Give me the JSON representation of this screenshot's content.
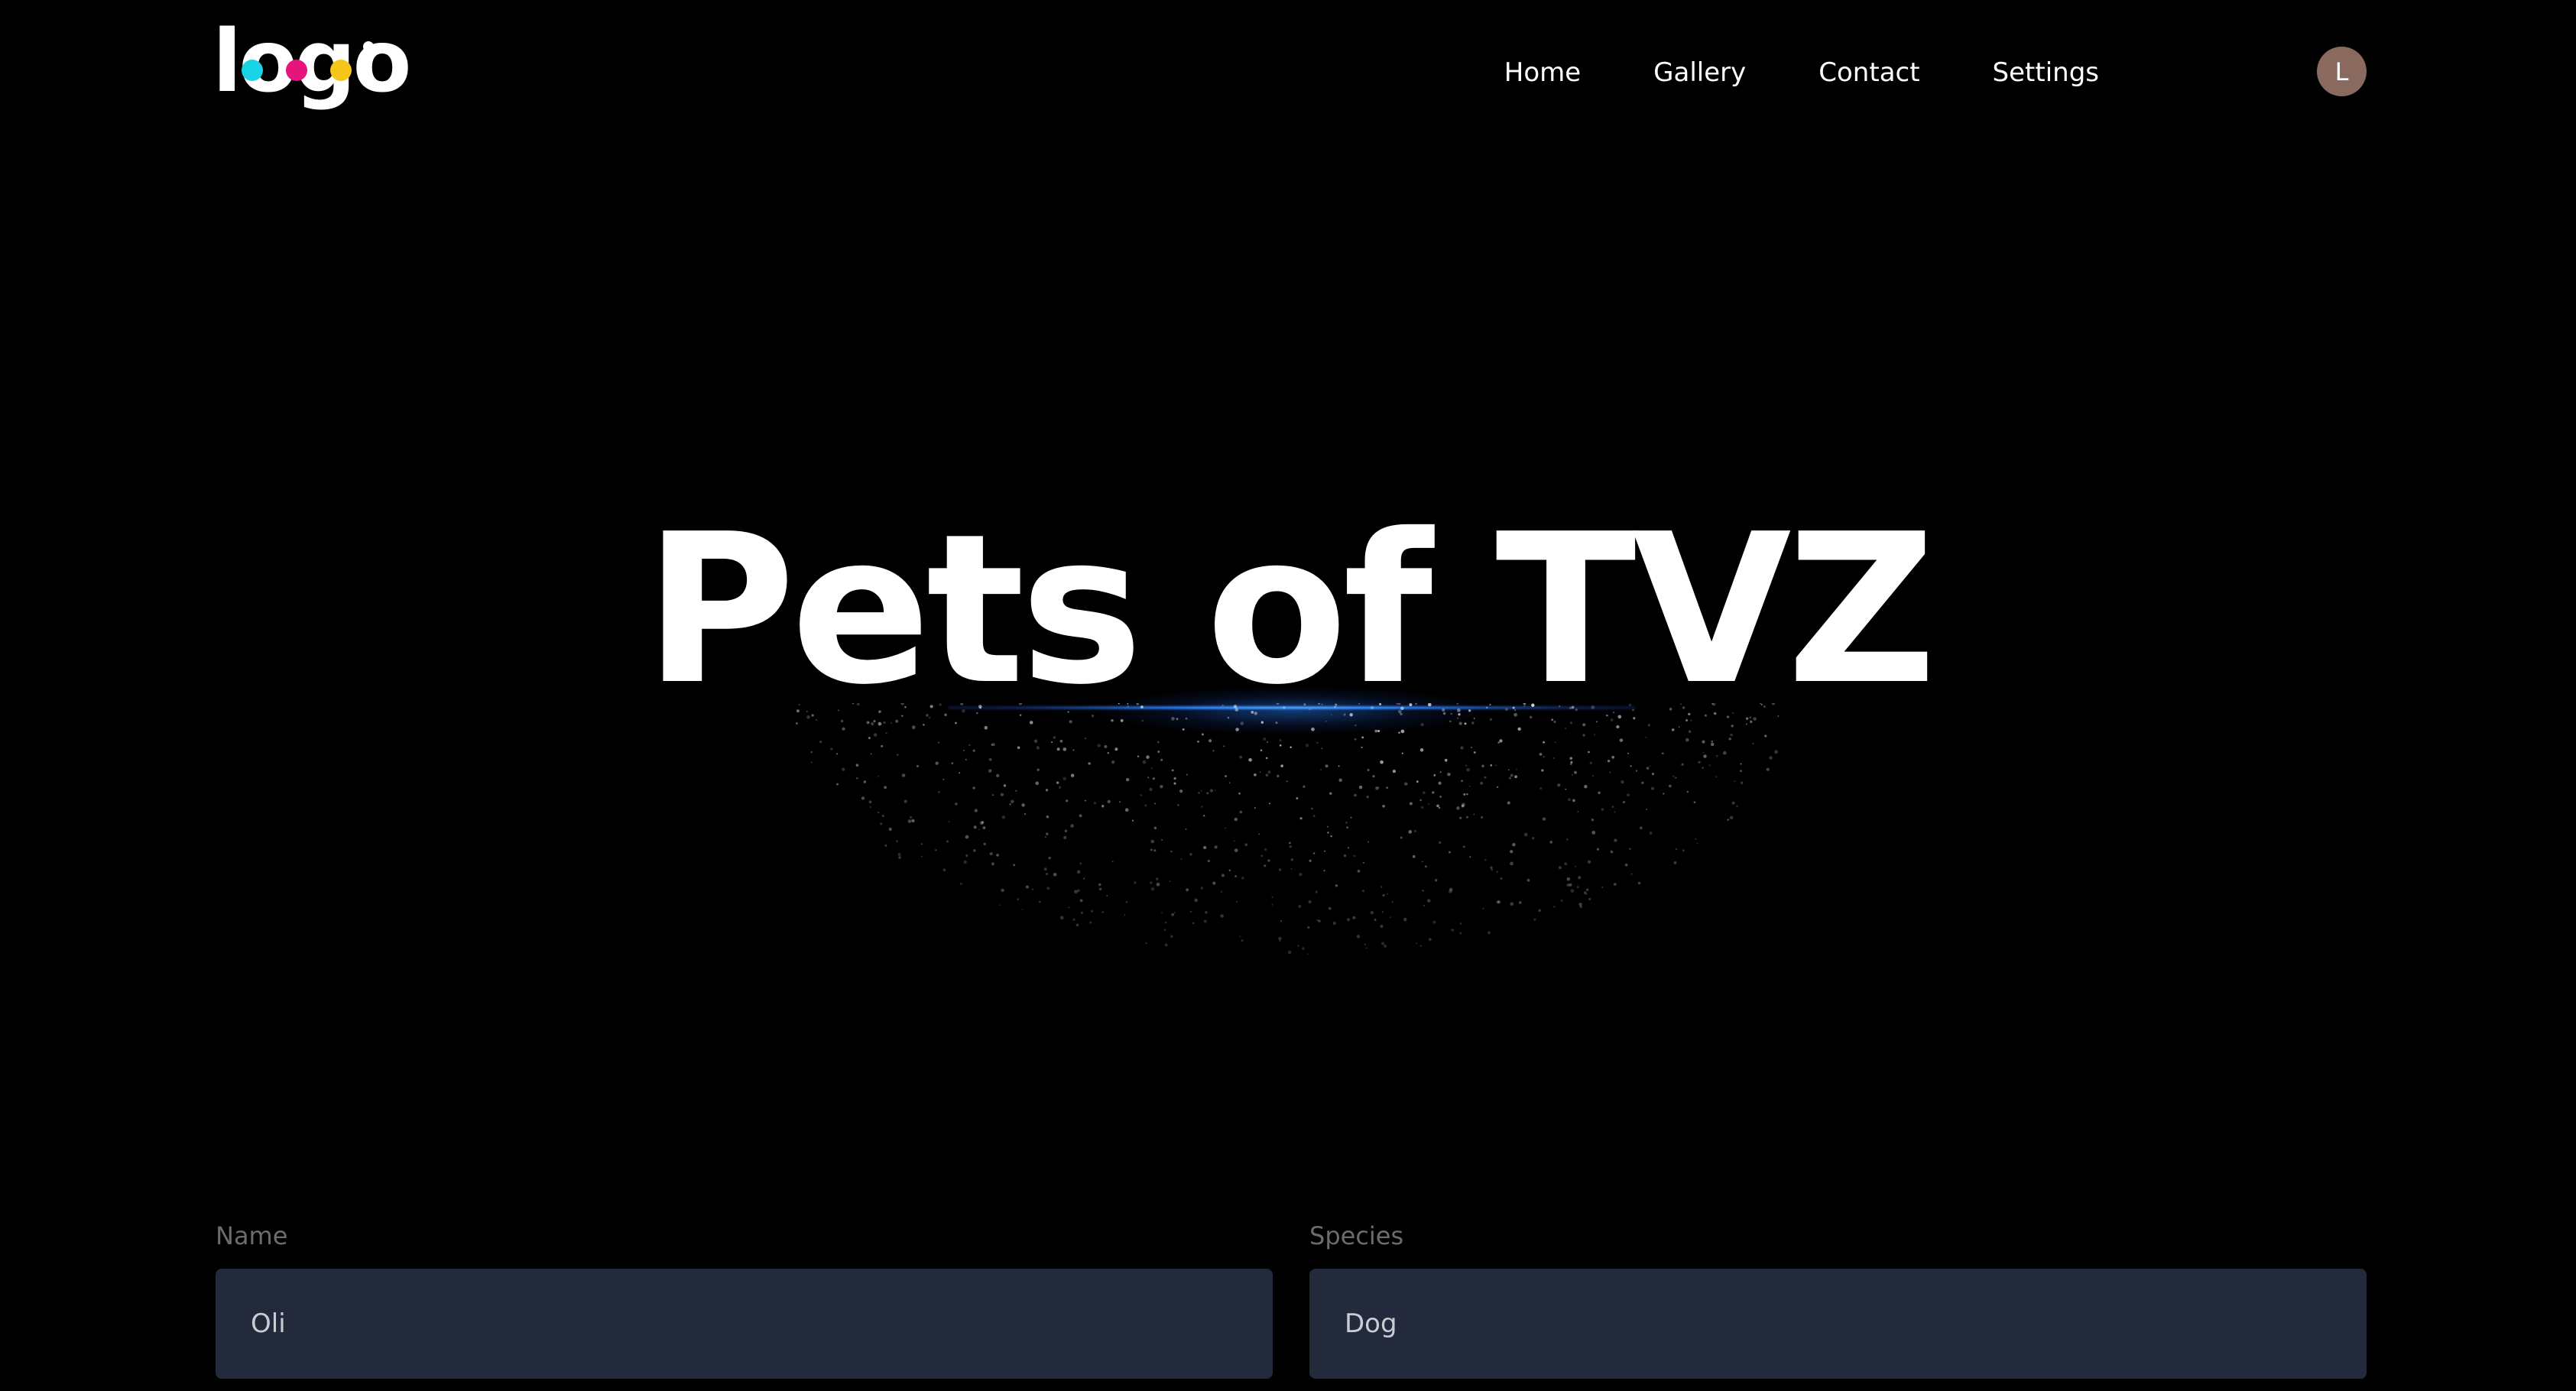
{
  "header": {
    "logo": {
      "text": "logo",
      "dot_colors": [
        "#19d3e6",
        "#e6157d",
        "#f5c518",
        "#ffffff"
      ]
    },
    "nav": [
      {
        "label": "Home"
      },
      {
        "label": "Gallery"
      },
      {
        "label": "Contact"
      },
      {
        "label": "Settings"
      }
    ],
    "avatar": {
      "initial": "L",
      "color": "#8a6a5e"
    }
  },
  "hero": {
    "title": "Pets of TVZ",
    "glow_color": "#2a8cff"
  },
  "form": {
    "name": {
      "label": "Name",
      "value": "Oli"
    },
    "species": {
      "label": "Species",
      "value": "Dog"
    }
  }
}
